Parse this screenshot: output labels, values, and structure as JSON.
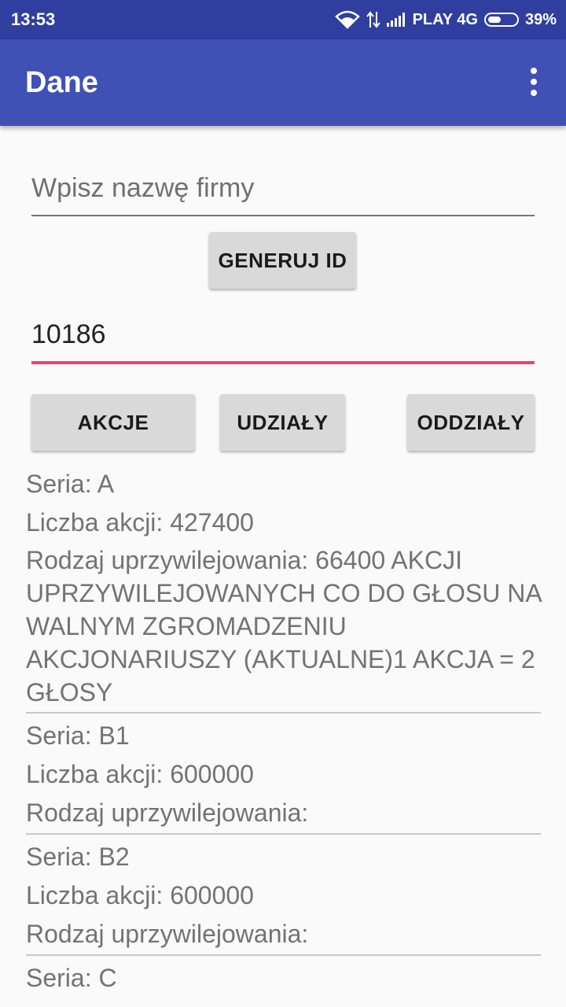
{
  "status_bar": {
    "time": "13:53",
    "carrier": "PLAY 4G",
    "battery": "39%",
    "battery_level": 0.39,
    "icons": [
      "wifi-icon",
      "data-transfer-icon",
      "signal-icon",
      "battery-icon"
    ]
  },
  "app_bar": {
    "title": "Dane",
    "menu_icon": "more-vert-icon"
  },
  "company_field": {
    "placeholder": "Wpisz nazwę firmy",
    "value": ""
  },
  "generate_button": {
    "label": "GENERUJ ID"
  },
  "id_field": {
    "value": "10186",
    "accent": "#ec407a"
  },
  "tabs": {
    "akcje": "AKCJE",
    "udzialy": "UDZIAŁY",
    "oddzialy": "ODDZIAŁY"
  },
  "series": [
    {
      "seria": "Seria: A",
      "liczba": "Liczba akcji: 427400",
      "rodzaj": "Rodzaj uprzywilejowania: 66400 AKCJI UPRZYWILEJOWANYCH CO DO GŁOSU NA WALNYM ZGROMADZENIU AKCJONARIUSZY (AKTUALNE)1 AKCJA = 2 GŁOSY"
    },
    {
      "seria": "Seria: B1",
      "liczba": "Liczba akcji: 600000",
      "rodzaj": "Rodzaj uprzywilejowania:"
    },
    {
      "seria": "Seria: B2",
      "liczba": "Liczba akcji: 600000",
      "rodzaj": "Rodzaj uprzywilejowania:"
    },
    {
      "seria": "Seria: C"
    }
  ],
  "colors": {
    "status_bar": "#303f9f",
    "app_bar": "#3f51b5",
    "background": "#fafafa",
    "button": "#d9d9d9"
  }
}
